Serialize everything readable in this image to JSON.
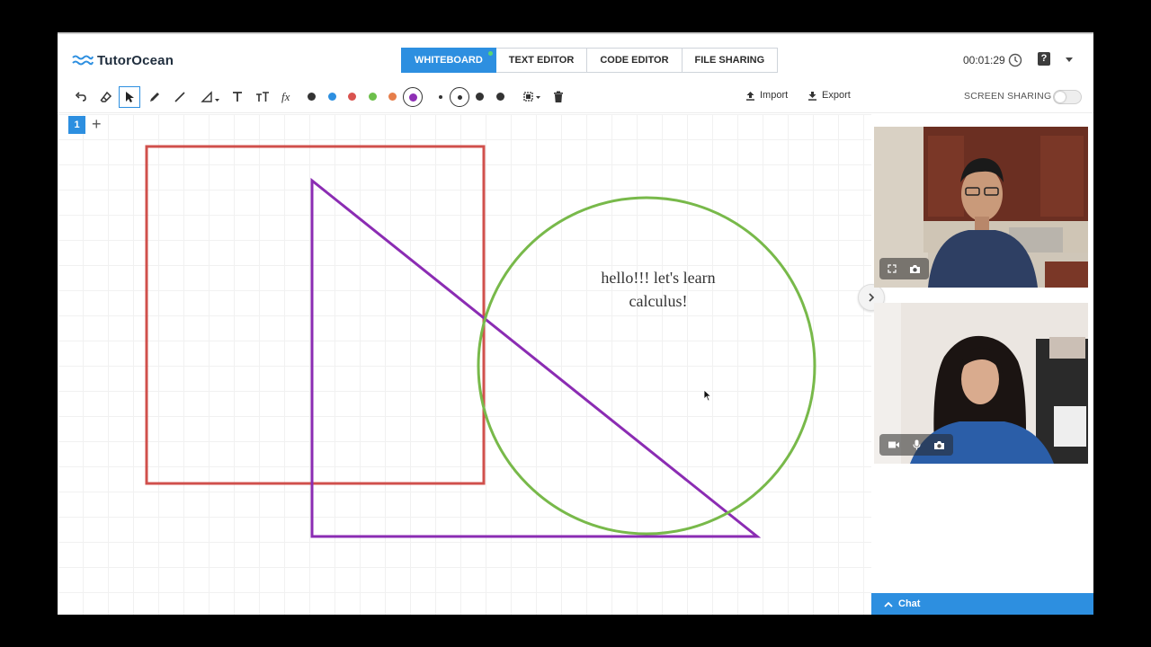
{
  "app": {
    "name": "TutorOcean"
  },
  "tabs": [
    {
      "label": "WHITEBOARD",
      "active": true
    },
    {
      "label": "TEXT EDITOR",
      "active": false
    },
    {
      "label": "CODE EDITOR",
      "active": false
    },
    {
      "label": "FILE SHARING",
      "active": false
    }
  ],
  "session": {
    "timer": "00:01:29",
    "help_label": "?"
  },
  "toolbar": {
    "tools": [
      "undo-icon",
      "eraser-icon",
      "select-icon",
      "pencil-icon",
      "line-icon",
      "shape-icon",
      "text-icon",
      "text-size-icon",
      "formula-icon"
    ],
    "colors": [
      "#333333",
      "#2d8fe0",
      "#d9534f",
      "#6cbf4b",
      "#e67e4a",
      "#8e2fb5"
    ],
    "selected_color": "#8e2fb5",
    "import_label": "Import",
    "export_label": "Export",
    "screen_sharing_label": "SCREEN SHARING",
    "screen_sharing_on": false
  },
  "board": {
    "page_number": "1",
    "add_page": "+",
    "text_line1": "hello!!! let's learn",
    "text_line2": "calculus!",
    "shape_colors": {
      "square": "#d0504c",
      "triangle": "#8b2cb3",
      "circle": "#78b94a"
    }
  },
  "chat": {
    "label": "Chat"
  }
}
